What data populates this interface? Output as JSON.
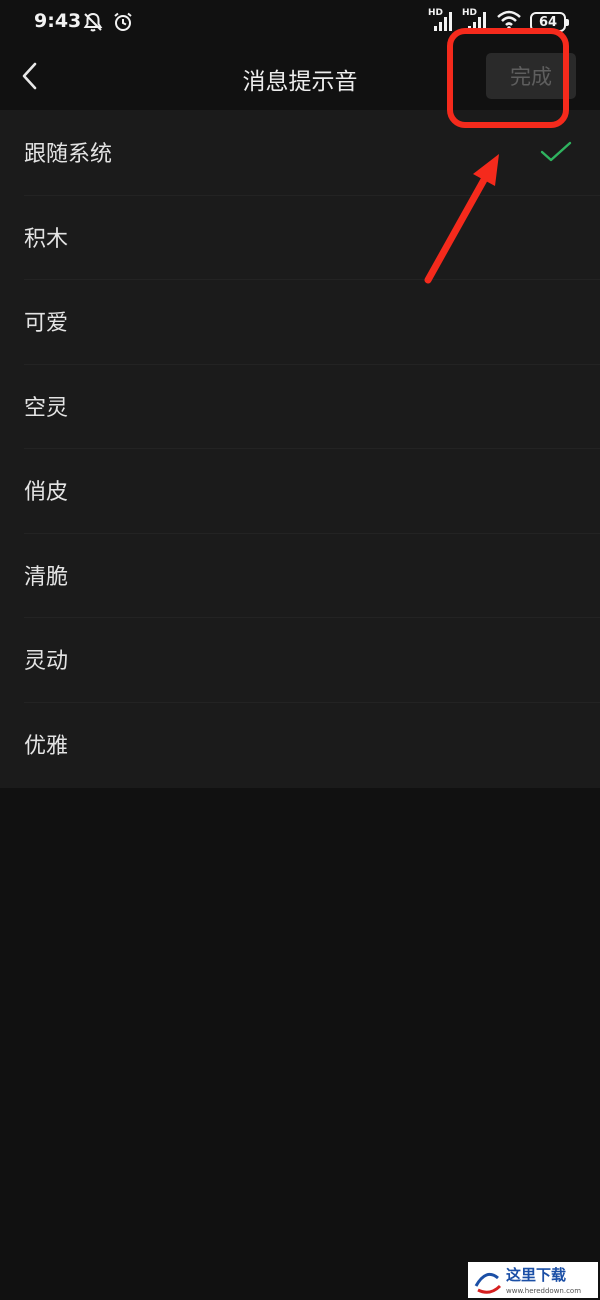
{
  "status_bar": {
    "time": "9:43",
    "battery": "64",
    "signal_label_1": "HD",
    "signal_label_2": "HD",
    "icons": [
      "bell-muted-icon",
      "alarm-icon",
      "signal-icon",
      "signal-icon",
      "wifi-icon",
      "battery-icon"
    ]
  },
  "nav": {
    "back_icon": "chevron-left-icon",
    "title": "消息提示音",
    "done_label": "完成"
  },
  "tones": [
    {
      "label": "跟随系统",
      "selected": true
    },
    {
      "label": "积木",
      "selected": false
    },
    {
      "label": "可爱",
      "selected": false
    },
    {
      "label": "空灵",
      "selected": false
    },
    {
      "label": "俏皮",
      "selected": false
    },
    {
      "label": "清脆",
      "selected": false
    },
    {
      "label": "灵动",
      "selected": false
    },
    {
      "label": "优雅",
      "selected": false
    }
  ],
  "colors": {
    "background": "#111111",
    "list_background": "#1b1b1b",
    "check": "#2fb35f",
    "annotation": "#f52a1c",
    "done_text": "#5e5e5e"
  },
  "watermark": {
    "text": "这里下载",
    "url": "www.hereddown.com"
  }
}
